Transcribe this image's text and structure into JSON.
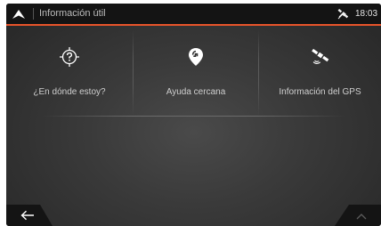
{
  "header": {
    "title": "Información útil",
    "clock": "18:03",
    "accent_color": "#e8542a",
    "icons": [
      "menu-arrow-icon",
      "satellite-icon"
    ]
  },
  "tiles": [
    {
      "label": "¿En dónde estoy?",
      "icon": "location-question-icon"
    },
    {
      "label": "Ayuda cercana",
      "icon": "help-pin-icon"
    },
    {
      "label": "Información del GPS",
      "icon": "satellite-icon"
    }
  ],
  "footer": {
    "back_icon": "back-arrow-icon",
    "up_icon": "chevron-up-icon"
  }
}
